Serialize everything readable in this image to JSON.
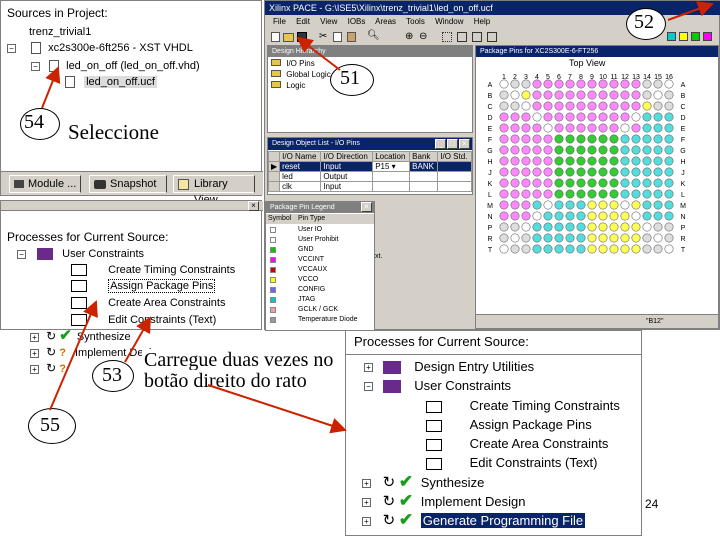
{
  "sources_panel": {
    "header": "Sources in Project:",
    "items": [
      "trenz_trivial1",
      "xc2s300e-6ft256 - XST VHDL",
      "led_on_off (led_on_off.vhd)",
      "led_on_off.ucf"
    ],
    "tabs": [
      "Module ...",
      "Snapshot ...",
      "Library View"
    ]
  },
  "processes_small": {
    "header": "Processes for Current Source:",
    "items": [
      "User Constraints",
      "Create Timing Constraints",
      "Assign Package Pins",
      "Create Area Constraints",
      "Edit Constraints (Text)",
      "Synthesize",
      "Implement Design"
    ]
  },
  "pace": {
    "title": "Xilinx PACE - G:\\ISE5\\Xilinx\\trenz_trivial1\\led_on_off.ucf",
    "menu": [
      "File",
      "Edit",
      "View",
      "IOBs",
      "Areas",
      "Tools",
      "Window",
      "Help"
    ],
    "hierarchy": {
      "title": "Design Hierarchy",
      "items": [
        "I/O Pins",
        "Global Logic",
        "Logic"
      ]
    },
    "package_pins": {
      "title": "Package Pins for XC2S300E-6-FT256",
      "view_label": "Top View",
      "columns": [
        "1",
        "2",
        "3",
        "4",
        "5",
        "6",
        "7",
        "8",
        "9",
        "10",
        "11",
        "12",
        "13",
        "14",
        "15",
        "16"
      ],
      "rows": [
        "A",
        "B",
        "C",
        "D",
        "E",
        "F",
        "G",
        "H",
        "J",
        "K",
        "L",
        "M",
        "N",
        "P",
        "R",
        "T"
      ],
      "status": "\"B12\""
    },
    "object_list": {
      "title": "Design Object List - I/O Pins",
      "headers": [
        "I/O Name",
        "I/O Direction",
        "Location",
        "Bank",
        "I/O Std."
      ],
      "rows": [
        {
          "name": "reset",
          "direction": "Input",
          "location": "P15",
          "bank": "BANK"
        },
        {
          "name": "led",
          "direction": "Output",
          "location": "",
          "bank": ""
        },
        {
          "name": "clk",
          "direction": "Input",
          "location": "",
          "bank": ""
        }
      ]
    },
    "legend": {
      "title": "Package Pin Legend",
      "headers": [
        "Symbol",
        "Pin Type"
      ],
      "items": [
        {
          "label": "User IO",
          "color": "#ffffff"
        },
        {
          "label": "User Prohibit",
          "color": "#ffffff"
        },
        {
          "label": "GND",
          "color": "#00cc00"
        },
        {
          "label": "VCCINT",
          "color": "#ff00ff"
        },
        {
          "label": "VCCAUX",
          "color": "#cc0000"
        },
        {
          "label": "VCCO",
          "color": "#ffff00"
        },
        {
          "label": "CONFIG",
          "color": "#6666ff"
        },
        {
          "label": "JTAG",
          "color": "#00cccc"
        },
        {
          "label": "GCLK / GCK",
          "color": "#ff9999"
        },
        {
          "label": "Temperature Diode",
          "color": "#999999"
        }
      ],
      "tail": "xt."
    }
  },
  "processes_large": {
    "header": "Processes for Current Source:",
    "items": [
      "Design Entry Utilities",
      "User Constraints",
      "Create Timing Constraints",
      "Assign Package Pins",
      "Create Area Constraints",
      "Edit Constraints (Text)",
      "Synthesize",
      "Implement Design",
      "Generate Programming File"
    ]
  },
  "annotations": {
    "n51": "51",
    "n52": "52",
    "n53": "53",
    "n54": "54",
    "n55": "55",
    "seleccione": "Seleccione",
    "carregue_1": "Carregue duas vezes no",
    "carregue_2": "botão direito do rato"
  },
  "page_number": "24",
  "colors": {
    "title_bar": "#0a246a",
    "selection": "#0a246a",
    "arrow_red": "#cc2200",
    "pin_green": "#00cc00",
    "pin_magenta": "#ff66ff",
    "pin_yellow": "#ffff33",
    "pin_cyan": "#33cccc"
  }
}
